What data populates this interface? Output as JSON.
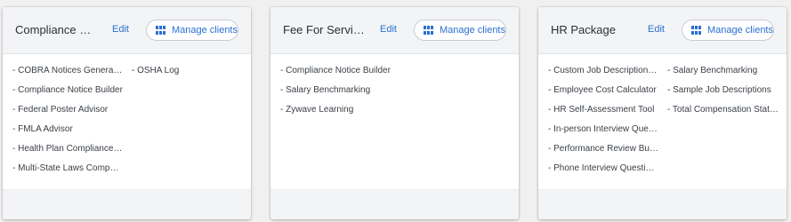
{
  "colors": {
    "accent": "#2a6fd1",
    "header_bg": "#f3f4f6",
    "card_bg": "#ffffff"
  },
  "cards": [
    {
      "title": "Compliance Pac...",
      "edit_label": "Edit",
      "manage_label": "Manage clients",
      "icon": "grid-icon",
      "column1": [
        "- COBRA Notices Generator",
        "- Compliance Notice Builder",
        "- Federal Poster Advisor",
        "- FMLA Advisor",
        "- Health Plan Compliance C...",
        "- Multi-State Laws Compari..."
      ],
      "column2": [
        "- OSHA Log"
      ]
    },
    {
      "title": "Fee For Service ...",
      "edit_label": "Edit",
      "manage_label": "Manage clients",
      "icon": "grid-icon",
      "column1": [
        "- Compliance Notice Builder",
        "- Salary Benchmarking",
        "- Zywave Learning"
      ],
      "column2": []
    },
    {
      "title": "HR Package",
      "edit_label": "Edit",
      "manage_label": "Manage clients",
      "icon": "grid-icon",
      "column1": [
        "- Custom Job Description B...",
        "- Employee Cost Calculator",
        "- HR Self-Assessment Tool",
        "- In-person Interview Quest...",
        "- Performance Review Build...",
        "- Phone Interview Question..."
      ],
      "column2": [
        "- Salary Benchmarking",
        "- Sample Job Descriptions",
        "- Total Compensation State..."
      ]
    }
  ]
}
